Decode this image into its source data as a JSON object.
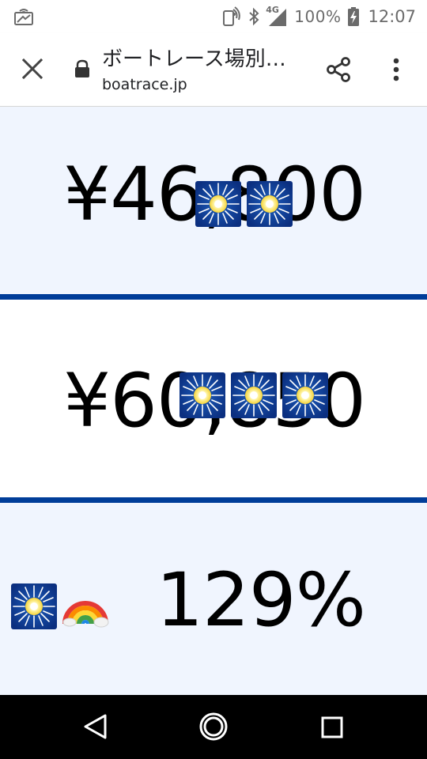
{
  "status_bar": {
    "battery_pct": "100%",
    "time": "12:07",
    "network": "4G",
    "icons": [
      "cast-icon",
      "nfc-icon",
      "bluetooth-icon",
      "signal-icon",
      "battery-charging-icon"
    ]
  },
  "toolbar": {
    "title": "ボートレース場別…",
    "url": "boatrace.jp",
    "icons": [
      "close-icon",
      "lock-icon",
      "share-icon",
      "more-vert-icon"
    ]
  },
  "content": {
    "values": [
      {
        "text": "¥46,800",
        "emojis": [
          "fireworks",
          "fireworks"
        ]
      },
      {
        "text": "¥60,850",
        "emojis": [
          "fireworks",
          "fireworks",
          "fireworks"
        ]
      },
      {
        "text": "129%",
        "emojis": [
          "fireworks",
          "rainbow"
        ]
      }
    ]
  },
  "colors": {
    "panel_tint": "#f0f5fe",
    "divider": "#003d99",
    "text": "#000000"
  },
  "nav_bar": {
    "icons": [
      "back-icon",
      "home-icon",
      "recents-icon"
    ]
  }
}
